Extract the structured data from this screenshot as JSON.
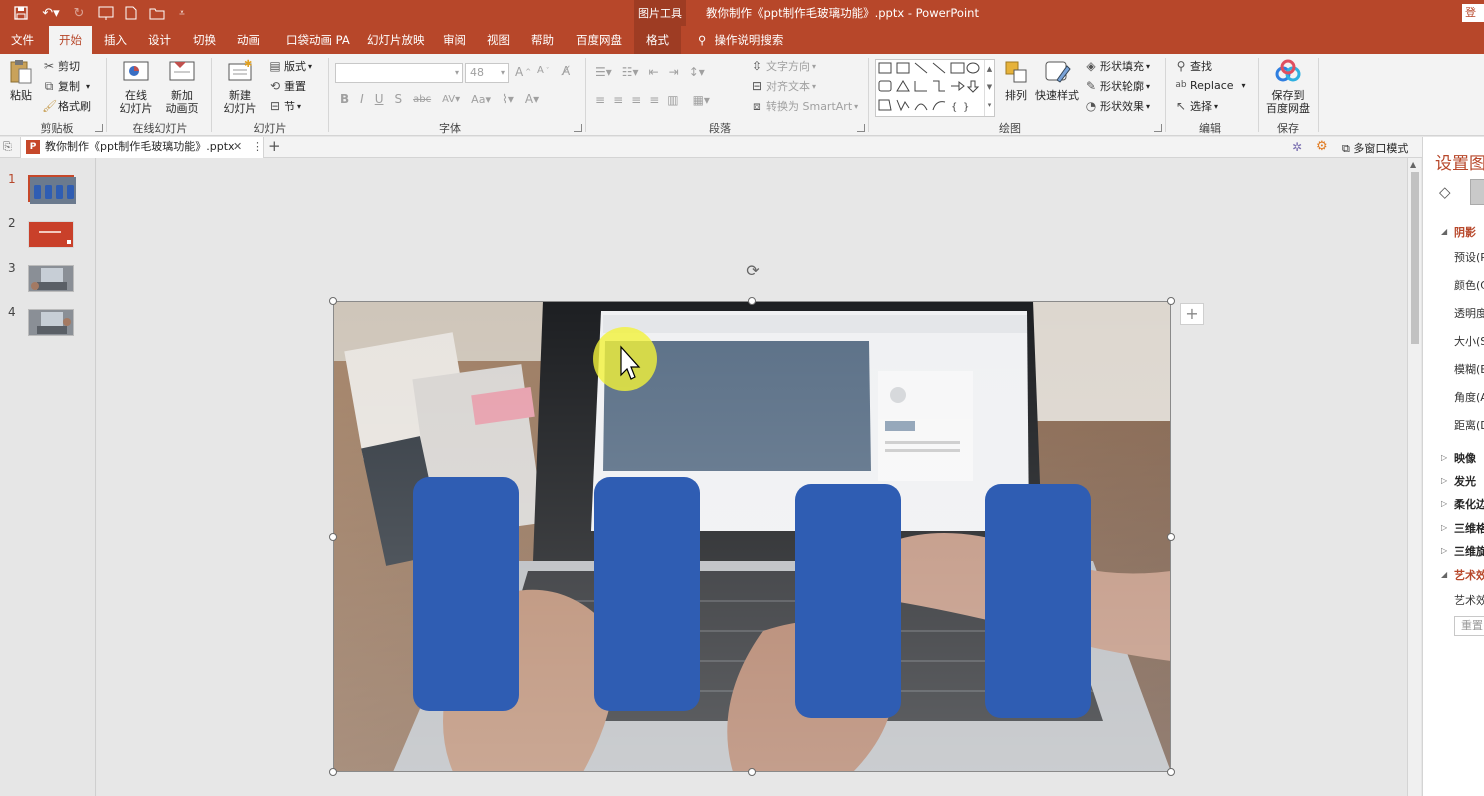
{
  "titlebar": {
    "context_group": "图片工具",
    "title": "教你制作《ppt制作毛玻璃功能》.pptx  -  PowerPoint",
    "login_label": "登"
  },
  "tabs": [
    {
      "label": "文件"
    },
    {
      "label": "开始"
    },
    {
      "label": "插入"
    },
    {
      "label": "设计"
    },
    {
      "label": "切换"
    },
    {
      "label": "动画"
    },
    {
      "label": "口袋动画 PA"
    },
    {
      "label": "幻灯片放映"
    },
    {
      "label": "审阅"
    },
    {
      "label": "视图"
    },
    {
      "label": "帮助"
    },
    {
      "label": "百度网盘"
    },
    {
      "label": "格式"
    }
  ],
  "tellme": "操作说明搜索",
  "ribbon": {
    "clipboard": {
      "paste": "粘贴",
      "cut": "剪切",
      "copy": "复制",
      "painter": "格式刷",
      "group": "剪贴板"
    },
    "online": {
      "online_slide": "在线\n幻灯片",
      "new_anim": "新加\n动画页",
      "group": "在线幻灯片"
    },
    "slides": {
      "new_slide": "新建\n幻灯片",
      "layout": "版式",
      "reset": "重置",
      "section": "节",
      "group": "幻灯片"
    },
    "font": {
      "size": "48",
      "group": "字体"
    },
    "paragraph": {
      "text_dir": "文字方向",
      "align_text": "对齐文本",
      "smartart": "转换为 SmartArt",
      "group": "段落"
    },
    "drawing": {
      "arrange": "排列",
      "quick_styles": "快速样式",
      "fill": "形状填充",
      "outline": "形状轮廓",
      "effects": "形状效果",
      "group": "绘图"
    },
    "editing": {
      "find": "查找",
      "replace": "Replace",
      "select": "选择",
      "group": "编辑"
    },
    "save": {
      "save_to": "保存到\n百度网盘",
      "group": "保存"
    }
  },
  "docbar": {
    "doc_tab": "教你制作《ppt制作毛玻璃功能》.pptx",
    "multi_window": "多窗口模式"
  },
  "thumbnails": [
    {
      "num": "1"
    },
    {
      "num": "2"
    },
    {
      "num": "3"
    },
    {
      "num": "4"
    }
  ],
  "pane": {
    "title": "设置图",
    "rows": {
      "shadow": "阴影",
      "preset": "预设(P",
      "color": "颜色(C",
      "transparency": "透明度",
      "size": "大小(S",
      "blur": "模糊(B",
      "angle": "角度(A",
      "distance": "距离(D",
      "reflection": "映像",
      "glow": "发光",
      "soft_edges": "柔化边",
      "3d_format": "三维格",
      "3d_rotation": "三维旋",
      "artistic": "艺术效",
      "artistic_sub": "艺术效",
      "reset": "重置("
    }
  },
  "colors": {
    "accent": "#b7472a",
    "card_blue": "#2f5db3"
  }
}
